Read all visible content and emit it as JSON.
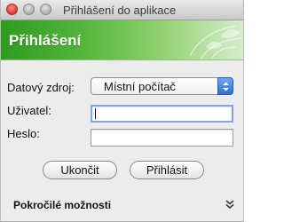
{
  "window": {
    "title": "Přihlášení do aplikace"
  },
  "banner": {
    "title": "Přihlášení"
  },
  "form": {
    "datasource_label": "Datový zdroj:",
    "datasource_value": "Místní počítač",
    "user_label": "Uživatel:",
    "user_value": "",
    "password_label": "Heslo:",
    "password_value": ""
  },
  "buttons": {
    "quit": "Ukončit",
    "login": "Přihlásit"
  },
  "advanced": {
    "label": "Pokročilé možnosti",
    "icon": "double-chevron-down-icon"
  },
  "colors": {
    "banner_green": "#55b63c",
    "stepper_blue": "#2f6fd3",
    "close_red": "#e0443e"
  }
}
